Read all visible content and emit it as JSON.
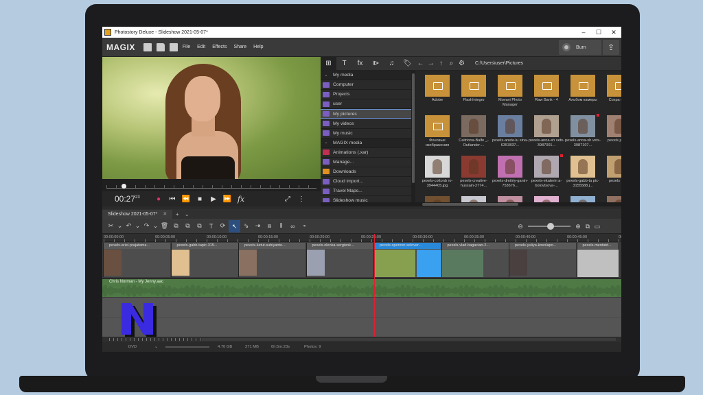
{
  "window": {
    "title": "Photostory Deluxe - Slideshow 2021-05-07*",
    "minimize": "–",
    "maximize": "☐",
    "close": "✕"
  },
  "menubar": {
    "brand": "MAGIX",
    "items": [
      "File",
      "Edit",
      "Effects",
      "Share",
      "Help"
    ],
    "burn_label": "Burn",
    "export_icon": "⇪"
  },
  "transport": {
    "timecode_main": "00:27",
    "timecode_frames": "23",
    "record": "●",
    "to_start": "⏮",
    "rewind": "⏪",
    "stop": "■",
    "play": "▶",
    "forward": "⏩",
    "fx": "fx",
    "fit_icon": "⤢",
    "more_icon": "⋮"
  },
  "media_toolbar": [
    "⊞",
    "T",
    "fx",
    "⧐",
    "♫",
    "🏷"
  ],
  "media_tree": [
    {
      "label": "My media",
      "type": "header"
    },
    {
      "label": "Computer",
      "color": "#7a5fc0"
    },
    {
      "label": "Projects",
      "color": "#7a5fc0"
    },
    {
      "label": "user",
      "color": "#7a5fc0"
    },
    {
      "label": "My pictures",
      "color": "#7a5fc0",
      "selected": true
    },
    {
      "label": "My videos",
      "color": "#7a5fc0"
    },
    {
      "label": "My music",
      "color": "#7a5fc0"
    },
    {
      "label": "MAGIX media",
      "type": "header"
    },
    {
      "label": "Animations (.xar)",
      "color": "#c03050"
    },
    {
      "label": "Manage...",
      "color": "#7a5fc0"
    },
    {
      "label": "Downloads",
      "color": "#e09020"
    },
    {
      "label": "Cloud import...",
      "color": "#7a5fc0"
    },
    {
      "label": "Travel Maps...",
      "color": "#7a5fc0"
    },
    {
      "label": "Slideshow music",
      "color": "#7a5fc0"
    }
  ],
  "file_toolbar": {
    "back": "←",
    "forward": "→",
    "up": "↑",
    "search": "⌕",
    "settings": "⚙",
    "path": "C:\\Users\\user\\Pictures"
  },
  "files": [
    {
      "label": "Adobe",
      "kind": "folder"
    },
    {
      "label": "FlashIntegro",
      "kind": "folder"
    },
    {
      "label": "Movavi Photo Manager",
      "kind": "folder"
    },
    {
      "label": "Raw Bank - 4",
      "kind": "folder"
    },
    {
      "label": "Альбом камеры",
      "kind": "folder"
    },
    {
      "label": "Сохра фото",
      "kind": "folder"
    },
    {
      "label": "Фоновые изображения",
      "kind": "folder"
    },
    {
      "label": "Caitriona-Balfe _-Outlander-...",
      "kind": "photo",
      "color": "#7a6a60"
    },
    {
      "label": "pexels-anete-lu sina-6353837...",
      "kind": "photo",
      "color": "#6a7fa0"
    },
    {
      "label": "pexels-anna-sh vets-3987001...",
      "kind": "photo",
      "color": "#b0a090"
    },
    {
      "label": "pexels-anna-sh vets-3987107...",
      "kind": "photo",
      "color": "#8090a0",
      "dot": true
    },
    {
      "label": "pexels jatama",
      "kind": "photo",
      "color": "#a08070"
    },
    {
      "label": "pexels-cottonb ro-3944405.jpg",
      "kind": "photo",
      "color": "#d8d8d8"
    },
    {
      "label": "pexels-creative-hussain-2774...",
      "kind": "photo",
      "color": "#8a3a30"
    },
    {
      "label": "pexels-dmitriy-ganin-753676...",
      "kind": "photo",
      "color": "#c070b0"
    },
    {
      "label": "pexels-ekaterin a-bolovtsova-...",
      "kind": "photo",
      "color": "#b0a8b0",
      "dot": true
    },
    {
      "label": "pexels-gabb-ta pic-3155588.j...",
      "kind": "photo",
      "color": "#e0c090"
    },
    {
      "label": "pexels vaicii",
      "kind": "photo",
      "color": "#c0a070"
    },
    {
      "label": "",
      "kind": "photo",
      "color": "#705030"
    },
    {
      "label": "",
      "kind": "photo",
      "color": "#c8c8d0"
    },
    {
      "label": "",
      "kind": "photo",
      "color": "#c090a0"
    },
    {
      "label": "",
      "kind": "photo",
      "color": "#e0b0d0"
    },
    {
      "label": "",
      "kind": "photo",
      "color": "#90b0d0"
    },
    {
      "label": "",
      "kind": "photo",
      "color": "#907060"
    }
  ],
  "timeline_tab": {
    "label": "Slideshow 2021-05-07*",
    "close": "✕",
    "add": "+",
    "menu": "⌄"
  },
  "timeline_tools": [
    "✂",
    "⌄",
    "↶",
    "⌄",
    "↷",
    "⌄",
    "🗑",
    "⧉",
    "⧉",
    "⧉",
    "T",
    "⟳",
    "↖",
    "⇘",
    "⇥",
    "⧈",
    "⫴",
    "∞",
    "⌁"
  ],
  "zoom": {
    "minus": "⊖",
    "plus": "⊕",
    "fit": "⧉",
    "monitor": "▭"
  },
  "ruler": [
    "00:00:00:00",
    "00:00:05:00",
    "00:00:10:00",
    "00:00:15:00",
    "00:00:20:00",
    "00:00:25:00",
    "00:00:30:00",
    "00:00:35:00",
    "00:00:40:00",
    "00:00:45:00",
    "00:00:50:00"
  ],
  "clips": [
    {
      "name": "pexels-ariel-prajatama...",
      "color": "#6a5040"
    },
    {
      "name": "pexels-gabb-tapic-315...",
      "color": "#e0c090"
    },
    {
      "name": "pexels-ketut-subiyanto...",
      "color": "#8a7060"
    },
    {
      "name": "pexels-olenka-sergienk...",
      "color": "#9aa0b0"
    },
    {
      "name": "pexels-spencer-selover...",
      "color": "#86a050",
      "selected": true
    },
    {
      "name": "pexels-vlad-bagacian-2...",
      "color": "#5a7a60"
    },
    {
      "name": "pexels-yuliya-kosolapo...",
      "color": "#4a4040"
    },
    {
      "name": "pexels-mentatd...",
      "color": "#c0c0c0"
    }
  ],
  "audio": {
    "name": "Chris Norman - My Jenny.aac"
  },
  "status": {
    "format": "DVD",
    "size": "4.70 GB",
    "used": "271 MB",
    "duration": "0h:5m:23s",
    "photos": "Photos: 9"
  },
  "colors": {
    "accent": "#2a88d8",
    "playhead": "#e02030",
    "audio": "#4f7a46",
    "folder": "#c8923a",
    "logo": "#3a2ae0"
  }
}
